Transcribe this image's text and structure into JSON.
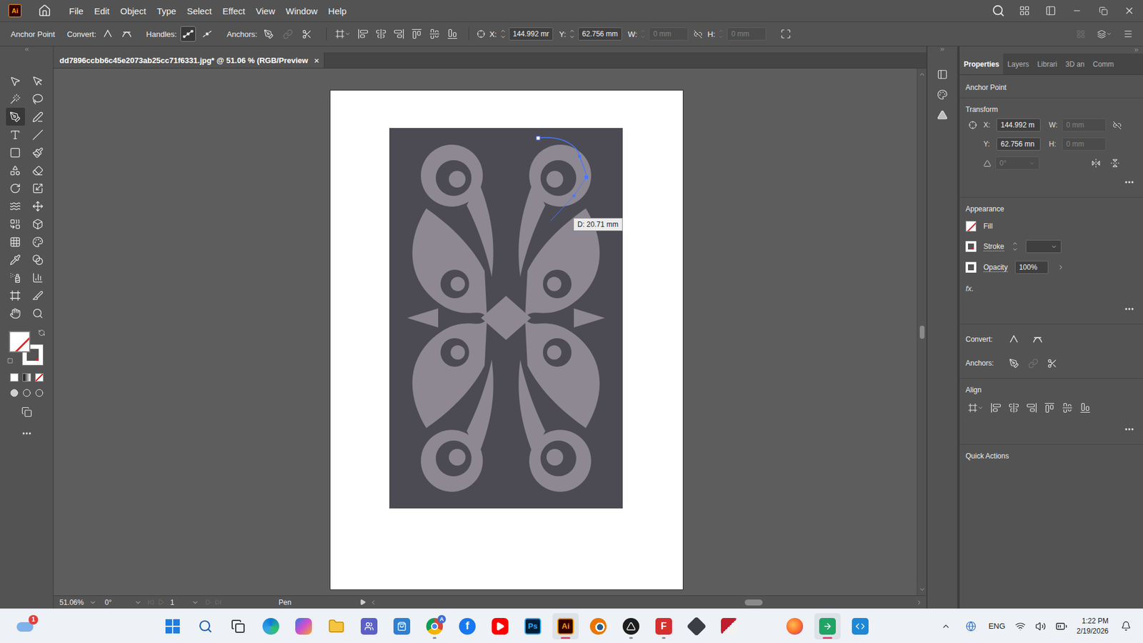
{
  "app": {
    "logo": "Ai"
  },
  "menu": [
    "File",
    "Edit",
    "Object",
    "Type",
    "Select",
    "Effect",
    "View",
    "Window",
    "Help"
  ],
  "control_bar": {
    "selection": "Anchor Point",
    "convert": "Convert:",
    "handles": "Handles:",
    "anchors": "Anchors:",
    "handle_buttons": [
      {
        "selected": true
      },
      {
        "selected": false
      }
    ],
    "anchor_buttons": [
      {
        "disabled": false
      },
      {
        "disabled": true
      },
      {
        "disabled": false
      }
    ],
    "x": {
      "label": "X:",
      "value": "144.992 mr"
    },
    "y": {
      "label": "Y:",
      "value": "62.756 mm"
    },
    "w": {
      "label": "W:",
      "value": "0 mm",
      "disabled": true
    },
    "h": {
      "label": "H:",
      "value": "0 mm",
      "disabled": true
    }
  },
  "document": {
    "title": "dd7896ccbb6c45e2073ab25cc71f6331.jpg* @ 51.06 % (RGB/Preview",
    "close": "×"
  },
  "tools": [
    {
      "kind": "selection",
      "selected": false
    },
    {
      "kind": "direct-selection",
      "selected": false
    },
    {
      "kind": "magic-wand",
      "selected": false
    },
    {
      "kind": "lasso",
      "selected": false
    },
    {
      "kind": "pen",
      "selected": true
    },
    {
      "kind": "curvature",
      "selected": false
    },
    {
      "kind": "type",
      "selected": false
    },
    {
      "kind": "line",
      "selected": false
    },
    {
      "kind": "rectangle",
      "selected": false
    },
    {
      "kind": "paintbrush",
      "selected": false
    },
    {
      "kind": "shaper",
      "selected": false
    },
    {
      "kind": "eraser",
      "selected": false
    },
    {
      "kind": "rotate",
      "selected": false
    },
    {
      "kind": "scale",
      "selected": false
    },
    {
      "kind": "width",
      "selected": false
    },
    {
      "kind": "free-transform",
      "selected": false
    },
    {
      "kind": "shape-builder",
      "selected": false
    },
    {
      "kind": "perspective",
      "selected": false
    },
    {
      "kind": "mesh",
      "selected": false
    },
    {
      "kind": "gradient",
      "selected": false
    },
    {
      "kind": "eyedropper",
      "selected": false
    },
    {
      "kind": "blend",
      "selected": false
    },
    {
      "kind": "symbol-sprayer",
      "selected": false
    },
    {
      "kind": "graph",
      "selected": false
    },
    {
      "kind": "artboard",
      "selected": false
    },
    {
      "kind": "slice",
      "selected": false
    },
    {
      "kind": "hand",
      "selected": false
    },
    {
      "kind": "zoom",
      "selected": false
    }
  ],
  "swatches": {
    "fill_none": true,
    "stroke_none": true
  },
  "canvas": {
    "measure_tooltip": "D: 20.71 mm"
  },
  "status_bar": {
    "zoom": "51.06%",
    "rotation": "0°",
    "artboard": "1",
    "tool": "Pen"
  },
  "panel": {
    "tabs": [
      {
        "label": "Properties",
        "selected": true
      },
      {
        "label": "Layers",
        "selected": false
      },
      {
        "label": "Librari",
        "selected": false
      },
      {
        "label": "3D an",
        "selected": false
      },
      {
        "label": "Comm",
        "selected": false
      }
    ],
    "selection": "Anchor Point",
    "transform": {
      "title": "Transform",
      "x": {
        "label": "X:",
        "value": "144.992 m"
      },
      "y": {
        "label": "Y:",
        "value": "62.756 mn"
      },
      "w": {
        "label": "W:",
        "value": "0 mm",
        "disabled": true
      },
      "h": {
        "label": "H:",
        "value": "0 mm",
        "disabled": true
      },
      "angle": {
        "value": "0°",
        "disabled": true
      }
    },
    "appearance": {
      "title": "Appearance",
      "fill": {
        "label": "Fill",
        "none": true
      },
      "stroke": {
        "label": "Stroke",
        "none": true
      },
      "opacity": "Opacity",
      "opacity_value": "100%",
      "fx": "fx."
    },
    "convert": "Convert:",
    "anchors": "Anchors:",
    "anchor_buttons": [
      {
        "disabled": false
      },
      {
        "disabled": true
      },
      {
        "disabled": false
      }
    ],
    "align": "Align",
    "quick_actions": "Quick Actions"
  },
  "taskbar": {
    "weather_badge": "1",
    "apps": [
      {
        "kind": "start",
        "running": false,
        "active": false
      },
      {
        "kind": "search",
        "running": false,
        "active": false
      },
      {
        "kind": "task-view",
        "running": false,
        "active": false
      },
      {
        "kind": "edge",
        "running": false,
        "active": false
      },
      {
        "kind": "copilot",
        "running": false,
        "active": false
      },
      {
        "kind": "explorer",
        "running": false,
        "active": false
      },
      {
        "kind": "teams",
        "running": false,
        "active": false
      },
      {
        "kind": "store",
        "running": false,
        "active": false
      },
      {
        "kind": "chrome",
        "badge": "A",
        "running": true,
        "active": false
      },
      {
        "kind": "facebook",
        "label": "f",
        "running": false,
        "active": false
      },
      {
        "kind": "youtube",
        "running": false,
        "active": false
      },
      {
        "kind": "photoshop",
        "label": "Ps",
        "running": false,
        "active": false
      },
      {
        "kind": "illustrator",
        "label": "Ai",
        "running": true,
        "active": true
      },
      {
        "kind": "blender",
        "running": false,
        "active": false
      },
      {
        "kind": "inkscape",
        "running": true,
        "active": false
      },
      {
        "kind": "figma",
        "label": "F",
        "running": true,
        "active": false
      },
      {
        "kind": "affinity",
        "running": false,
        "active": false
      },
      {
        "kind": "filezilla",
        "running": false,
        "active": false
      },
      {
        "kind": "firefox",
        "running": false,
        "active": false
      },
      {
        "kind": "green-app",
        "running": true,
        "active": true
      },
      {
        "kind": "vscode",
        "running": false,
        "active": false
      }
    ],
    "language": "ENG",
    "time": "1:22 PM",
    "date": "2/19/2026"
  }
}
